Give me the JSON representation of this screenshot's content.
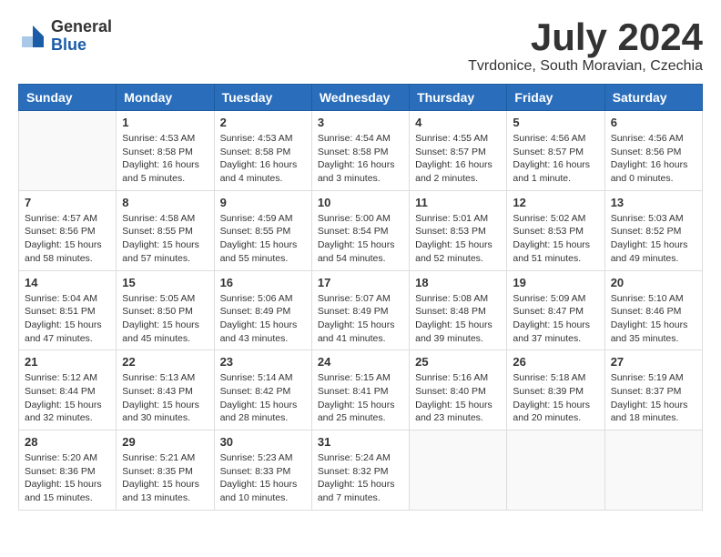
{
  "header": {
    "logo": {
      "text_general": "General",
      "text_blue": "Blue"
    },
    "month_title": "July 2024",
    "location": "Tvrdonice, South Moravian, Czechia"
  },
  "weekdays": [
    "Sunday",
    "Monday",
    "Tuesday",
    "Wednesday",
    "Thursday",
    "Friday",
    "Saturday"
  ],
  "weeks": [
    [
      {
        "day": "",
        "info": ""
      },
      {
        "day": "1",
        "info": "Sunrise: 4:53 AM\nSunset: 8:58 PM\nDaylight: 16 hours\nand 5 minutes."
      },
      {
        "day": "2",
        "info": "Sunrise: 4:53 AM\nSunset: 8:58 PM\nDaylight: 16 hours\nand 4 minutes."
      },
      {
        "day": "3",
        "info": "Sunrise: 4:54 AM\nSunset: 8:58 PM\nDaylight: 16 hours\nand 3 minutes."
      },
      {
        "day": "4",
        "info": "Sunrise: 4:55 AM\nSunset: 8:57 PM\nDaylight: 16 hours\nand 2 minutes."
      },
      {
        "day": "5",
        "info": "Sunrise: 4:56 AM\nSunset: 8:57 PM\nDaylight: 16 hours\nand 1 minute."
      },
      {
        "day": "6",
        "info": "Sunrise: 4:56 AM\nSunset: 8:56 PM\nDaylight: 16 hours\nand 0 minutes."
      }
    ],
    [
      {
        "day": "7",
        "info": "Sunrise: 4:57 AM\nSunset: 8:56 PM\nDaylight: 15 hours\nand 58 minutes."
      },
      {
        "day": "8",
        "info": "Sunrise: 4:58 AM\nSunset: 8:55 PM\nDaylight: 15 hours\nand 57 minutes."
      },
      {
        "day": "9",
        "info": "Sunrise: 4:59 AM\nSunset: 8:55 PM\nDaylight: 15 hours\nand 55 minutes."
      },
      {
        "day": "10",
        "info": "Sunrise: 5:00 AM\nSunset: 8:54 PM\nDaylight: 15 hours\nand 54 minutes."
      },
      {
        "day": "11",
        "info": "Sunrise: 5:01 AM\nSunset: 8:53 PM\nDaylight: 15 hours\nand 52 minutes."
      },
      {
        "day": "12",
        "info": "Sunrise: 5:02 AM\nSunset: 8:53 PM\nDaylight: 15 hours\nand 51 minutes."
      },
      {
        "day": "13",
        "info": "Sunrise: 5:03 AM\nSunset: 8:52 PM\nDaylight: 15 hours\nand 49 minutes."
      }
    ],
    [
      {
        "day": "14",
        "info": "Sunrise: 5:04 AM\nSunset: 8:51 PM\nDaylight: 15 hours\nand 47 minutes."
      },
      {
        "day": "15",
        "info": "Sunrise: 5:05 AM\nSunset: 8:50 PM\nDaylight: 15 hours\nand 45 minutes."
      },
      {
        "day": "16",
        "info": "Sunrise: 5:06 AM\nSunset: 8:49 PM\nDaylight: 15 hours\nand 43 minutes."
      },
      {
        "day": "17",
        "info": "Sunrise: 5:07 AM\nSunset: 8:49 PM\nDaylight: 15 hours\nand 41 minutes."
      },
      {
        "day": "18",
        "info": "Sunrise: 5:08 AM\nSunset: 8:48 PM\nDaylight: 15 hours\nand 39 minutes."
      },
      {
        "day": "19",
        "info": "Sunrise: 5:09 AM\nSunset: 8:47 PM\nDaylight: 15 hours\nand 37 minutes."
      },
      {
        "day": "20",
        "info": "Sunrise: 5:10 AM\nSunset: 8:46 PM\nDaylight: 15 hours\nand 35 minutes."
      }
    ],
    [
      {
        "day": "21",
        "info": "Sunrise: 5:12 AM\nSunset: 8:44 PM\nDaylight: 15 hours\nand 32 minutes."
      },
      {
        "day": "22",
        "info": "Sunrise: 5:13 AM\nSunset: 8:43 PM\nDaylight: 15 hours\nand 30 minutes."
      },
      {
        "day": "23",
        "info": "Sunrise: 5:14 AM\nSunset: 8:42 PM\nDaylight: 15 hours\nand 28 minutes."
      },
      {
        "day": "24",
        "info": "Sunrise: 5:15 AM\nSunset: 8:41 PM\nDaylight: 15 hours\nand 25 minutes."
      },
      {
        "day": "25",
        "info": "Sunrise: 5:16 AM\nSunset: 8:40 PM\nDaylight: 15 hours\nand 23 minutes."
      },
      {
        "day": "26",
        "info": "Sunrise: 5:18 AM\nSunset: 8:39 PM\nDaylight: 15 hours\nand 20 minutes."
      },
      {
        "day": "27",
        "info": "Sunrise: 5:19 AM\nSunset: 8:37 PM\nDaylight: 15 hours\nand 18 minutes."
      }
    ],
    [
      {
        "day": "28",
        "info": "Sunrise: 5:20 AM\nSunset: 8:36 PM\nDaylight: 15 hours\nand 15 minutes."
      },
      {
        "day": "29",
        "info": "Sunrise: 5:21 AM\nSunset: 8:35 PM\nDaylight: 15 hours\nand 13 minutes."
      },
      {
        "day": "30",
        "info": "Sunrise: 5:23 AM\nSunset: 8:33 PM\nDaylight: 15 hours\nand 10 minutes."
      },
      {
        "day": "31",
        "info": "Sunrise: 5:24 AM\nSunset: 8:32 PM\nDaylight: 15 hours\nand 7 minutes."
      },
      {
        "day": "",
        "info": ""
      },
      {
        "day": "",
        "info": ""
      },
      {
        "day": "",
        "info": ""
      }
    ]
  ]
}
